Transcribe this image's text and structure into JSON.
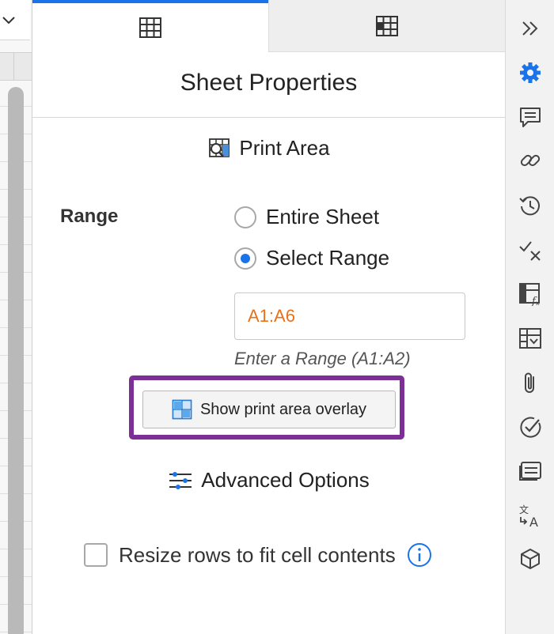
{
  "tabs": [
    {
      "icon": "grid-icon",
      "active": true
    },
    {
      "icon": "grid-fill-icon",
      "active": false
    }
  ],
  "panel": {
    "title": "Sheet Properties",
    "print_area": {
      "heading": "Print Area",
      "icon": "print-area-icon",
      "range_label": "Range",
      "options": [
        {
          "label": "Entire Sheet",
          "selected": false
        },
        {
          "label": "Select Range",
          "selected": true
        }
      ],
      "range_value": "A1:A6",
      "range_hint": "Enter a Range (A1:A2)",
      "overlay_button": "Show print area overlay"
    },
    "advanced": {
      "heading": "Advanced Options",
      "icon": "sliders-icon",
      "resize_rows_label": "Resize rows to fit cell contents",
      "resize_rows_checked": false
    }
  },
  "rail": {
    "icons": [
      "collapse-icon",
      "settings-icon",
      "comment-icon",
      "link-icon",
      "history-icon",
      "check-x-icon",
      "formula-icon",
      "table-dropdown-icon",
      "attachment-icon",
      "check-circle-icon",
      "list-card-icon",
      "translate-icon",
      "cube-icon"
    ]
  },
  "colors": {
    "accent": "#1a73e8",
    "highlight": "#7b2f97",
    "range_text": "#e8711a"
  }
}
